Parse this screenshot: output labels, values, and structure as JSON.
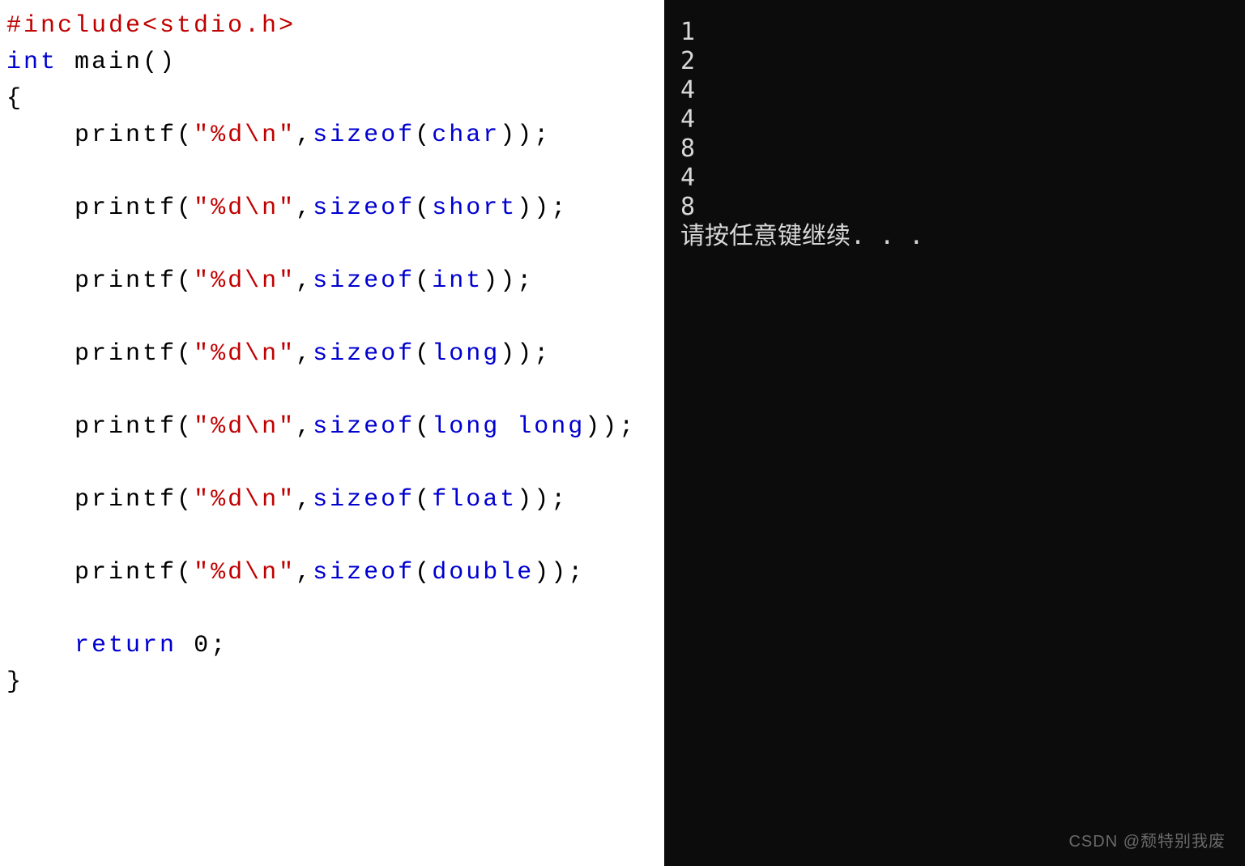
{
  "code": {
    "include_directive": "#include",
    "include_header": "<stdio.h>",
    "kw_int": "int",
    "fn_main": "main",
    "paren_pair": "()",
    "brace_open": "{",
    "brace_close": "}",
    "fn_printf": "printf",
    "lparen": "(",
    "rparen": ")",
    "comma": ",",
    "semicolon": ";",
    "str_open": "\"",
    "str_fmt": "%d",
    "str_esc": "\\n",
    "str_close": "\"",
    "kw_sizeof": "sizeof",
    "type_char": "char",
    "type_short": "short",
    "type_int": "int",
    "type_long": "long",
    "type_longlong": "long long",
    "type_float": "float",
    "type_double": "double",
    "kw_return": "return",
    "lit_zero": "0"
  },
  "console": {
    "lines": {
      "l0": "1",
      "l1": "2",
      "l2": "4",
      "l3": "4",
      "l4": "8",
      "l5": "4",
      "l6": "8"
    },
    "prompt": "请按任意键继续. . ."
  },
  "watermark": "CSDN @颓特别我废"
}
